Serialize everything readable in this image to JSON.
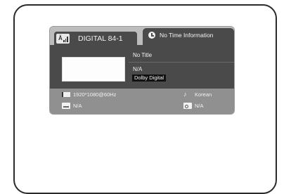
{
  "channel": {
    "icon": "antenna-signal-icon",
    "label": "DIGITAL 84-1"
  },
  "time": {
    "icon": "clock-icon",
    "text": "No Time Information"
  },
  "program": {
    "title": "No Title",
    "detail": "N/A",
    "audio": "Dolby Digital"
  },
  "details": {
    "resolution_icon": "resolution-icon",
    "resolution": "1920*1080@60Hz",
    "language_icon": "language-icon",
    "language": "Korean",
    "subtitle_icon": "subtitle-icon",
    "subtitle": "N/A",
    "rating_icon": "rating-lock-icon",
    "rating": "N/A"
  },
  "colors": {
    "panel_dark": "#4a4a4a",
    "panel_light": "#bdbdbd",
    "footer": "#909090",
    "text": "#f2f2f2",
    "audio_badge": "#111111"
  }
}
